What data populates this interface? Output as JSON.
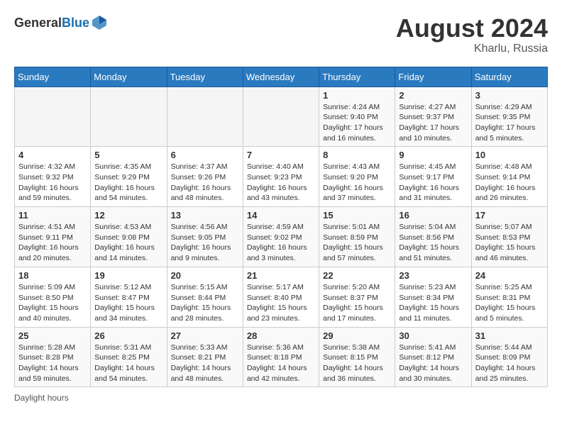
{
  "header": {
    "logo_general": "General",
    "logo_blue": "Blue",
    "month_year": "August 2024",
    "location": "Kharlu, Russia"
  },
  "weekdays": [
    "Sunday",
    "Monday",
    "Tuesday",
    "Wednesday",
    "Thursday",
    "Friday",
    "Saturday"
  ],
  "weeks": [
    [
      {
        "day": "",
        "info": ""
      },
      {
        "day": "",
        "info": ""
      },
      {
        "day": "",
        "info": ""
      },
      {
        "day": "",
        "info": ""
      },
      {
        "day": "1",
        "info": "Sunrise: 4:24 AM\nSunset: 9:40 PM\nDaylight: 17 hours\nand 16 minutes."
      },
      {
        "day": "2",
        "info": "Sunrise: 4:27 AM\nSunset: 9:37 PM\nDaylight: 17 hours\nand 10 minutes."
      },
      {
        "day": "3",
        "info": "Sunrise: 4:29 AM\nSunset: 9:35 PM\nDaylight: 17 hours\nand 5 minutes."
      }
    ],
    [
      {
        "day": "4",
        "info": "Sunrise: 4:32 AM\nSunset: 9:32 PM\nDaylight: 16 hours\nand 59 minutes."
      },
      {
        "day": "5",
        "info": "Sunrise: 4:35 AM\nSunset: 9:29 PM\nDaylight: 16 hours\nand 54 minutes."
      },
      {
        "day": "6",
        "info": "Sunrise: 4:37 AM\nSunset: 9:26 PM\nDaylight: 16 hours\nand 48 minutes."
      },
      {
        "day": "7",
        "info": "Sunrise: 4:40 AM\nSunset: 9:23 PM\nDaylight: 16 hours\nand 43 minutes."
      },
      {
        "day": "8",
        "info": "Sunrise: 4:43 AM\nSunset: 9:20 PM\nDaylight: 16 hours\nand 37 minutes."
      },
      {
        "day": "9",
        "info": "Sunrise: 4:45 AM\nSunset: 9:17 PM\nDaylight: 16 hours\nand 31 minutes."
      },
      {
        "day": "10",
        "info": "Sunrise: 4:48 AM\nSunset: 9:14 PM\nDaylight: 16 hours\nand 26 minutes."
      }
    ],
    [
      {
        "day": "11",
        "info": "Sunrise: 4:51 AM\nSunset: 9:11 PM\nDaylight: 16 hours\nand 20 minutes."
      },
      {
        "day": "12",
        "info": "Sunrise: 4:53 AM\nSunset: 9:08 PM\nDaylight: 16 hours\nand 14 minutes."
      },
      {
        "day": "13",
        "info": "Sunrise: 4:56 AM\nSunset: 9:05 PM\nDaylight: 16 hours\nand 9 minutes."
      },
      {
        "day": "14",
        "info": "Sunrise: 4:59 AM\nSunset: 9:02 PM\nDaylight: 16 hours\nand 3 minutes."
      },
      {
        "day": "15",
        "info": "Sunrise: 5:01 AM\nSunset: 8:59 PM\nDaylight: 15 hours\nand 57 minutes."
      },
      {
        "day": "16",
        "info": "Sunrise: 5:04 AM\nSunset: 8:56 PM\nDaylight: 15 hours\nand 51 minutes."
      },
      {
        "day": "17",
        "info": "Sunrise: 5:07 AM\nSunset: 8:53 PM\nDaylight: 15 hours\nand 46 minutes."
      }
    ],
    [
      {
        "day": "18",
        "info": "Sunrise: 5:09 AM\nSunset: 8:50 PM\nDaylight: 15 hours\nand 40 minutes."
      },
      {
        "day": "19",
        "info": "Sunrise: 5:12 AM\nSunset: 8:47 PM\nDaylight: 15 hours\nand 34 minutes."
      },
      {
        "day": "20",
        "info": "Sunrise: 5:15 AM\nSunset: 8:44 PM\nDaylight: 15 hours\nand 28 minutes."
      },
      {
        "day": "21",
        "info": "Sunrise: 5:17 AM\nSunset: 8:40 PM\nDaylight: 15 hours\nand 23 minutes."
      },
      {
        "day": "22",
        "info": "Sunrise: 5:20 AM\nSunset: 8:37 PM\nDaylight: 15 hours\nand 17 minutes."
      },
      {
        "day": "23",
        "info": "Sunrise: 5:23 AM\nSunset: 8:34 PM\nDaylight: 15 hours\nand 11 minutes."
      },
      {
        "day": "24",
        "info": "Sunrise: 5:25 AM\nSunset: 8:31 PM\nDaylight: 15 hours\nand 5 minutes."
      }
    ],
    [
      {
        "day": "25",
        "info": "Sunrise: 5:28 AM\nSunset: 8:28 PM\nDaylight: 14 hours\nand 59 minutes."
      },
      {
        "day": "26",
        "info": "Sunrise: 5:31 AM\nSunset: 8:25 PM\nDaylight: 14 hours\nand 54 minutes."
      },
      {
        "day": "27",
        "info": "Sunrise: 5:33 AM\nSunset: 8:21 PM\nDaylight: 14 hours\nand 48 minutes."
      },
      {
        "day": "28",
        "info": "Sunrise: 5:36 AM\nSunset: 8:18 PM\nDaylight: 14 hours\nand 42 minutes."
      },
      {
        "day": "29",
        "info": "Sunrise: 5:38 AM\nSunset: 8:15 PM\nDaylight: 14 hours\nand 36 minutes."
      },
      {
        "day": "30",
        "info": "Sunrise: 5:41 AM\nSunset: 8:12 PM\nDaylight: 14 hours\nand 30 minutes."
      },
      {
        "day": "31",
        "info": "Sunrise: 5:44 AM\nSunset: 8:09 PM\nDaylight: 14 hours\nand 25 minutes."
      }
    ]
  ],
  "footer": {
    "daylight_note": "Daylight hours"
  }
}
